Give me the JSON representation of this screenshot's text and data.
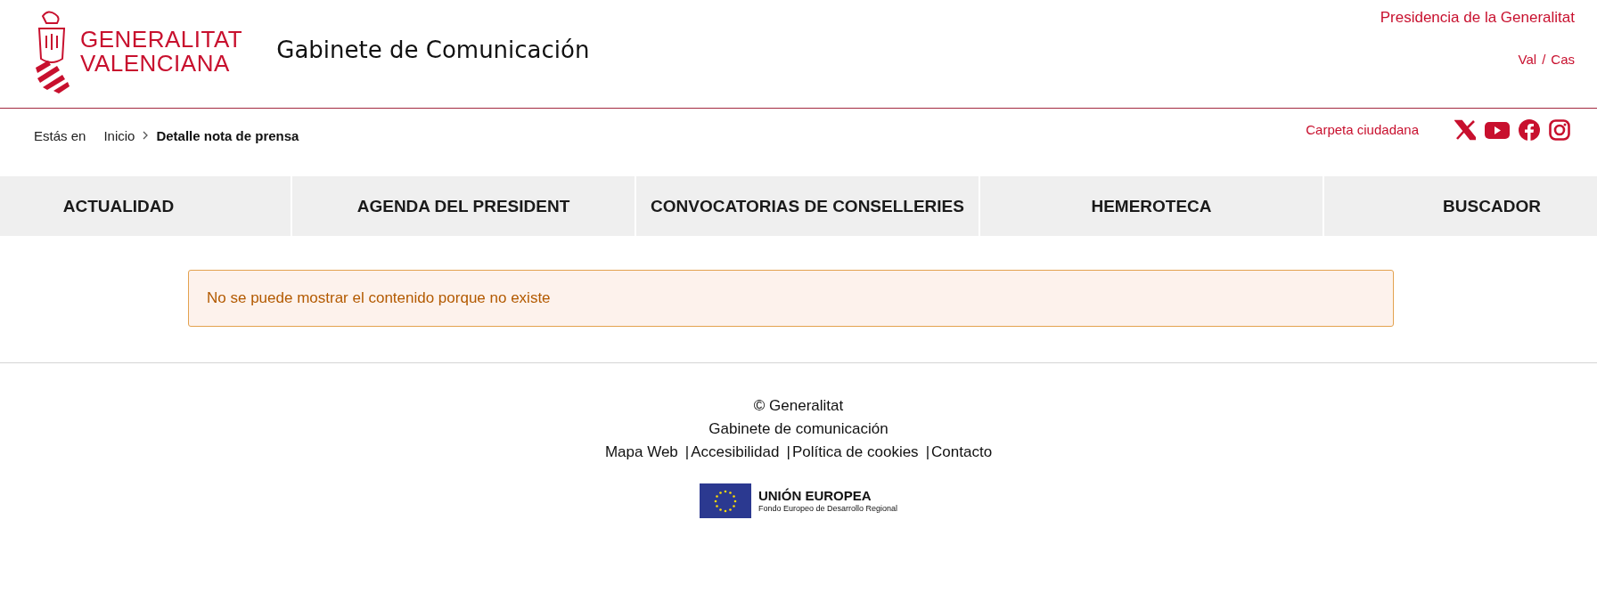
{
  "header": {
    "logo": {
      "lines": [
        "GENERALITAT",
        "VALENCIANA"
      ]
    },
    "title": "Gabinete de Comunicación",
    "organization": "Presidencia de la Generalitat",
    "languages": [
      {
        "label": "Val",
        "separator": "/"
      },
      {
        "label": "Cas"
      }
    ]
  },
  "breadcrumb": {
    "prefix": "Estás en",
    "items": [
      {
        "label": "Inicio",
        "current": false
      },
      {
        "label": "Detalle nota de prensa",
        "current": true
      }
    ]
  },
  "utility": {
    "link": "Carpeta ciudadana",
    "social": [
      {
        "kind": "x"
      },
      {
        "kind": "youtube"
      },
      {
        "kind": "facebook"
      },
      {
        "kind": "instagram"
      }
    ]
  },
  "nav": {
    "items": [
      {
        "label": "ACTUALIDAD"
      },
      {
        "label": "AGENDA DEL PRESIDENT"
      },
      {
        "label": "CONVOCATORIAS DE CONSELLERIES"
      },
      {
        "label": "HEMEROTECA"
      },
      {
        "label": "BUSCADOR"
      }
    ]
  },
  "alert": {
    "kind": "warning",
    "message": "No se puede mostrar el contenido porque no existe"
  },
  "footer": {
    "copyright": "© Generalitat",
    "subtitle": "Gabinete de comunicación",
    "links": [
      {
        "kind": "link",
        "text": "Mapa Web"
      },
      {
        "kind": "separator",
        "text": "|"
      },
      {
        "kind": "link",
        "text": "Accesibilidad"
      },
      {
        "kind": "separator",
        "text": "|"
      },
      {
        "kind": "link",
        "text": "Política de cookies"
      },
      {
        "kind": "separator",
        "text": "|"
      },
      {
        "kind": "link",
        "text": "Contacto"
      }
    ],
    "eu": {
      "title": "UNIÓN EUROPEA",
      "subtitle": "Fondo Europeo de Desarrollo Regional"
    }
  }
}
